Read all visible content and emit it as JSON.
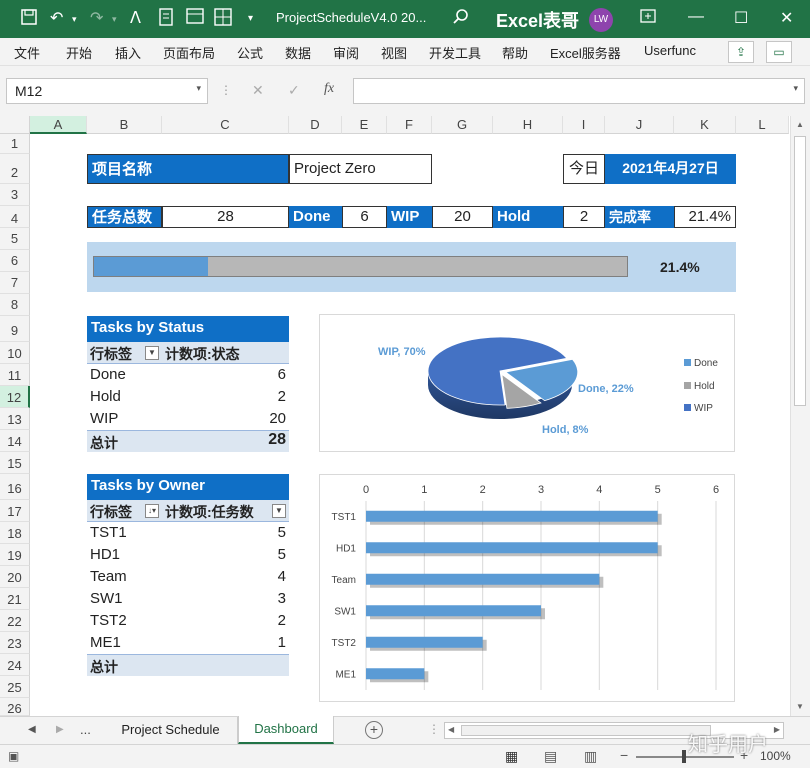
{
  "titlebar": {
    "filename": "ProjectScheduleV4.0 20...",
    "brand": "Excel表哥",
    "avatar": "LW"
  },
  "menu": [
    "文件",
    "开始",
    "插入",
    "页面布局",
    "公式",
    "数据",
    "审阅",
    "视图",
    "开发工具",
    "帮助",
    "Excel服务器",
    "Userfunc"
  ],
  "formula_bar": {
    "name_box": "M12",
    "fx": "fx",
    "content": ""
  },
  "columns": [
    "A",
    "B",
    "C",
    "D",
    "E",
    "F",
    "G",
    "H",
    "I",
    "J",
    "K",
    "L"
  ],
  "rows": [
    "1",
    "2",
    "3",
    "4",
    "5",
    "6",
    "7",
    "8",
    "9",
    "10",
    "11",
    "12",
    "13",
    "14",
    "15",
    "16",
    "17",
    "18",
    "19",
    "20",
    "21",
    "22",
    "23",
    "24",
    "25",
    "26"
  ],
  "project": {
    "label": "项目名称",
    "name": "Project Zero",
    "today_label": "今日",
    "today_value": "2021年4月27日"
  },
  "stats": {
    "total_label": "任务总数",
    "total": "28",
    "done_label": "Done",
    "done": "6",
    "wip_label": "WIP",
    "wip": "20",
    "hold_label": "Hold",
    "hold": "2",
    "rate_label": "完成率",
    "rate": "21.4%"
  },
  "progress": {
    "fraction": 0.214,
    "label": "21.4%"
  },
  "status_pivot": {
    "title": "Tasks by Status",
    "col1": "行标签",
    "col2": "计数项:状态",
    "rows": [
      {
        "name": "Done",
        "value": "6"
      },
      {
        "name": "Hold",
        "value": "2"
      },
      {
        "name": "WIP",
        "value": "20"
      }
    ],
    "total_label": "总计",
    "total": "28"
  },
  "owner_pivot": {
    "title": "Tasks by Owner",
    "col1": "行标签",
    "col2": "计数项:任务数",
    "rows": [
      {
        "name": "TST1",
        "value": "5"
      },
      {
        "name": "HD1",
        "value": "5"
      },
      {
        "name": "Team",
        "value": "4"
      },
      {
        "name": "SW1",
        "value": "3"
      },
      {
        "name": "TST2",
        "value": "2"
      },
      {
        "name": "ME1",
        "value": "1"
      }
    ],
    "total_label": "总计"
  },
  "chart_data": [
    {
      "type": "pie",
      "categories": [
        "Done",
        "Hold",
        "WIP"
      ],
      "values": [
        22,
        8,
        70
      ],
      "data_labels": [
        "Done, 22%",
        "Hold, 8%",
        "WIP, 70%"
      ],
      "legend": [
        "Done",
        "Hold",
        "WIP"
      ],
      "legend_position": "right",
      "colors": {
        "Done": "#5b9bd5",
        "Hold": "#a5a5a5",
        "WIP": "#4472c4"
      }
    },
    {
      "type": "bar",
      "orientation": "horizontal",
      "categories": [
        "TST1",
        "HD1",
        "Team",
        "SW1",
        "TST2",
        "ME1"
      ],
      "values": [
        5,
        5,
        4,
        3,
        2,
        1
      ],
      "xlim": [
        0,
        6
      ],
      "ticks": [
        "0",
        "1",
        "2",
        "3",
        "4",
        "5",
        "6"
      ],
      "grid": true,
      "color": "#5b9bd5"
    }
  ],
  "sheets": {
    "nav_more": "...",
    "tabs": [
      "Project Schedule",
      "Dashboard"
    ],
    "active": "Dashboard"
  },
  "status": {
    "zoom": "100%",
    "watermark": "知乎用户"
  },
  "colors": {
    "excel_green": "#217346",
    "header_blue": "#0f6fc6",
    "pivot_light": "#dce6f1"
  }
}
